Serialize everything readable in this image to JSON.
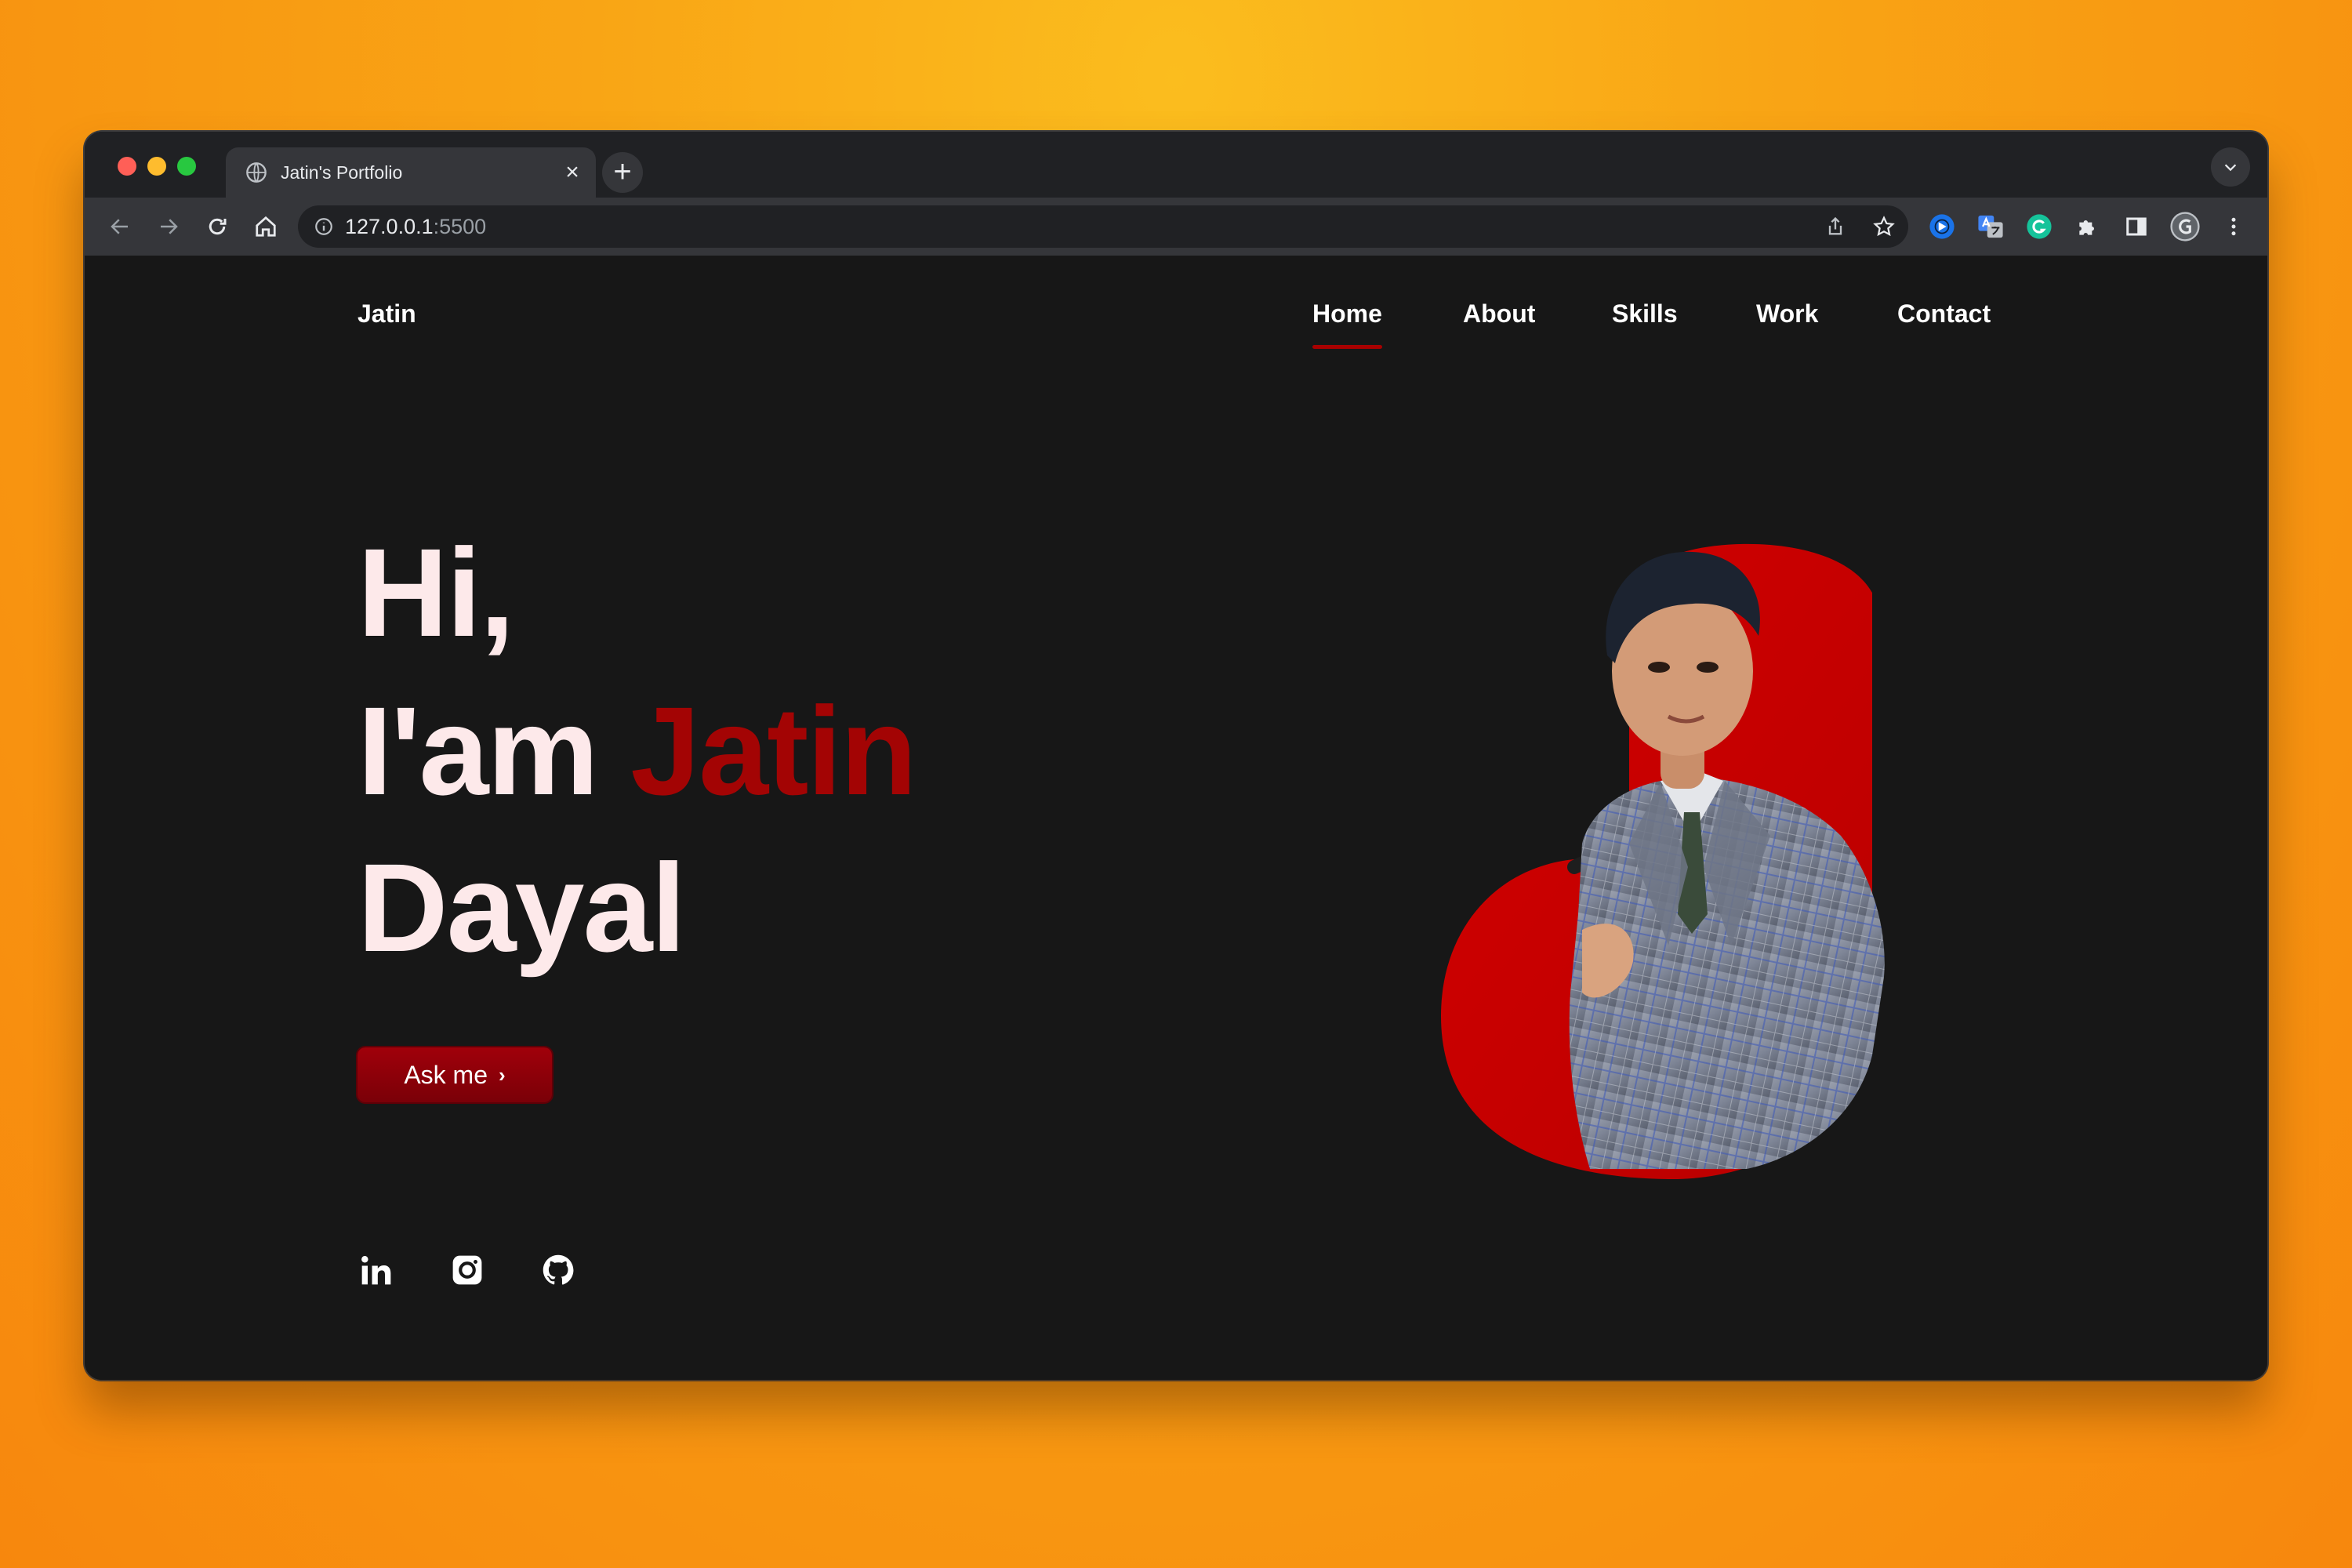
{
  "browser": {
    "tab_title": "Jatin's Portfolio",
    "url_host": "127.0.0.1",
    "url_port": ":5500"
  },
  "site": {
    "logo": "Jatin",
    "nav": [
      "Home",
      "About",
      "Skills",
      "Work",
      "Contact"
    ],
    "active_nav": "Home",
    "hero": {
      "line1": "Hi,",
      "line2_prefix": "I'am ",
      "line2_accent": "Jatin",
      "line3": "Dayal"
    },
    "cta_label": "Ask me",
    "social_icons": [
      "linkedin-icon",
      "instagram-icon",
      "github-icon"
    ]
  },
  "colors": {
    "accent": "#a30404",
    "page_bg": "#171717",
    "hero_text": "#fde9ea",
    "backdrop": "#f9a515"
  }
}
